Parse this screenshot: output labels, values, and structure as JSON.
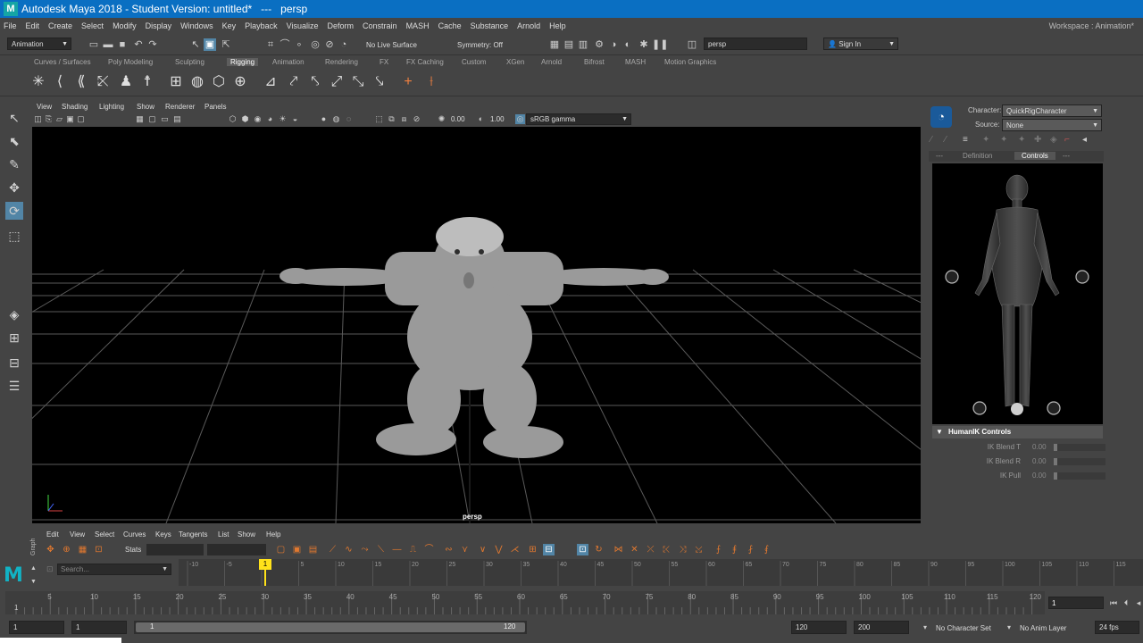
{
  "window": {
    "title": "Autodesk Maya 2018 - Student Version: untitled*   ---   persp",
    "logo": "M"
  },
  "menubar": {
    "items": [
      "File",
      "Edit",
      "Create",
      "Select",
      "Modify",
      "Display",
      "Windows",
      "Key",
      "Playback",
      "Visualize",
      "Deform",
      "Constrain",
      "MASH",
      "Cache",
      "Substance",
      "Arnold",
      "Help"
    ],
    "workspace_label": "Workspace :",
    "workspace_value": "Animation*"
  },
  "statusline": {
    "menuset": "Animation",
    "live_surface": "No Live Surface",
    "symmetry": "Symmetry: Off",
    "camera_field": "persp",
    "sign_in": "Sign In"
  },
  "shelf": {
    "tabs": [
      "Curves / Surfaces",
      "Poly Modeling",
      "Sculpting",
      "Rigging",
      "Animation",
      "Rendering",
      "FX",
      "FX Caching",
      "Custom",
      "XGen",
      "Arnold",
      "Bifrost",
      "MASH",
      "Motion Graphics"
    ],
    "active_tab": "Rigging"
  },
  "viewport": {
    "menu": [
      "View",
      "Shading",
      "Lighting",
      "Show",
      "Renderer",
      "Panels"
    ],
    "exposure": "0.00",
    "gamma": "1.00",
    "colorspace": "sRGB gamma",
    "camera_label": "persp"
  },
  "humanik": {
    "character_label": "Character:",
    "character_value": "QuickRigCharacter",
    "source_label": "Source:",
    "source_value": "None",
    "tabs": [
      "---",
      "Definition",
      "Controls",
      "---"
    ],
    "active_tab": "Controls",
    "controls_header": "HumanIK Controls",
    "rows": [
      {
        "label": "IK Blend T",
        "value": "0.00"
      },
      {
        "label": "IK Blend R",
        "value": "0.00"
      },
      {
        "label": "IK Pull",
        "value": "0.00"
      }
    ]
  },
  "graph_editor": {
    "tab_label": "Graph",
    "menu": [
      "Edit",
      "View",
      "Select",
      "Curves",
      "Keys",
      "Tangents",
      "List",
      "Show",
      "Help"
    ],
    "stats_label": "Stats",
    "search_placeholder": "Search...",
    "ruler_ticks": [
      "-10",
      "-5",
      "1",
      "5",
      "10",
      "15",
      "20",
      "25",
      "30",
      "35",
      "40",
      "45",
      "50",
      "55",
      "60",
      "65",
      "70",
      "75",
      "80",
      "85",
      "90",
      "95",
      "100",
      "105",
      "110",
      "115"
    ],
    "current_frame_marker": "1"
  },
  "timeline": {
    "ticks": [
      "5",
      "10",
      "15",
      "20",
      "25",
      "30",
      "35",
      "40",
      "45",
      "50",
      "55",
      "60",
      "65",
      "70",
      "75",
      "80",
      "85",
      "90",
      "95",
      "100",
      "105",
      "110",
      "115",
      "120"
    ],
    "start_label": "1",
    "current_frame": "1"
  },
  "range": {
    "start": "1",
    "anim_start": "1",
    "slider_start": "1",
    "slider_end": "120",
    "anim_end": "120",
    "end": "200",
    "character_set": "No Character Set",
    "anim_layer": "No Anim Layer",
    "fps": "24 fps"
  }
}
